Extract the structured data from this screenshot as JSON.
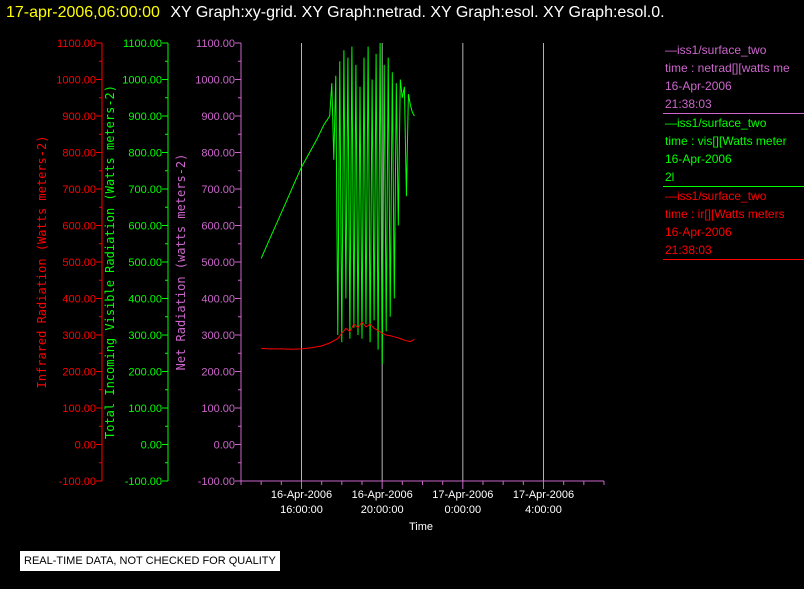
{
  "header": {
    "timestamp": "17-apr-2006,06:00:00",
    "graphs": "XY Graph:xy-grid.  XY Graph:netrad.  XY Graph:esol.  XY Graph:esol.0."
  },
  "legend": [
    {
      "lines": [
        "—iss1/surface_two",
        "time : netrad[][watts me",
        "16-Apr-2006",
        "21:38:03"
      ],
      "color": "#cc66cc"
    },
    {
      "lines": [
        "—iss1/surface_two",
        "time : vis[][Watts meter",
        "16-Apr-2006",
        "2l"
      ],
      "color": "#00ff00"
    },
    {
      "lines": [
        "—iss1/surface_two",
        "time : ir[][Watts meters",
        "16-Apr-2006",
        "21:38:03"
      ],
      "color": "#ff0000"
    }
  ],
  "footer": {
    "quality_note": "REAL-TIME DATA, NOT CHECKED FOR QUALITY"
  },
  "chart_data": {
    "type": "line",
    "xlabel": "Time",
    "x_ticks": [
      {
        "date": "16-Apr-2006",
        "time": "16:00:00",
        "hours": 16
      },
      {
        "date": "16-Apr-2006",
        "time": "20:00:00",
        "hours": 20
      },
      {
        "date": "17-Apr-2006",
        "time": "0:00:00",
        "hours": 24
      },
      {
        "date": "17-Apr-2006",
        "time": "4:00:00",
        "hours": 28
      }
    ],
    "xlim": [
      "16-Apr-2006 13:00",
      "17-Apr-2006 07:00"
    ],
    "xlim_hours": [
      13,
      31
    ],
    "grid": true,
    "axes": [
      {
        "id": "ir",
        "label": "Infrared Radiation (Watts meters-2)",
        "color": "#ff0000",
        "ylim": [
          -100,
          1100
        ],
        "ticks": [
          "-100.00",
          "0.00",
          "100.00",
          "200.00",
          "300.00",
          "400.00",
          "500.00",
          "600.00",
          "700.00",
          "800.00",
          "900.00",
          "1000.00",
          "1100.00"
        ]
      },
      {
        "id": "vis",
        "label": "Total Incoming Visible Radiation (Watts meters-2)",
        "color": "#00ff00",
        "ylim": [
          -100,
          1100
        ],
        "ticks": [
          "-100.00",
          "0.00",
          "100.00",
          "200.00",
          "300.00",
          "400.00",
          "500.00",
          "600.00",
          "700.00",
          "800.00",
          "900.00",
          "1000.00",
          "1100.00"
        ]
      },
      {
        "id": "net",
        "label": "Net Radiation (watts meters-2)",
        "color": "#cc66cc",
        "ylim": [
          -100,
          1100
        ],
        "ticks": [
          "-100.00",
          "0.00",
          "100.00",
          "200.00",
          "300.00",
          "400.00",
          "500.00",
          "600.00",
          "700.00",
          "800.00",
          "900.00",
          "1000.00",
          "1100.00"
        ]
      }
    ],
    "series": [
      {
        "name": "time : vis[][Watts meter",
        "axis": "vis",
        "color": "#00ff00",
        "x": [
          14.0,
          14.4,
          14.8,
          15.2,
          15.6,
          16.0,
          16.4,
          16.8,
          17.1,
          17.4,
          17.5,
          17.6,
          17.7,
          17.8,
          17.9,
          18.0,
          18.1,
          18.2,
          18.3,
          18.4,
          18.5,
          18.6,
          18.7,
          18.8,
          18.9,
          19.0,
          19.1,
          19.2,
          19.3,
          19.4,
          19.5,
          19.6,
          19.7,
          19.8,
          19.9,
          20.0,
          20.1,
          20.2,
          20.3,
          20.4,
          20.5,
          20.6,
          20.7,
          20.8,
          20.9,
          21.0,
          21.1,
          21.2,
          21.3,
          21.4,
          21.5,
          21.6
        ],
        "y": [
          510,
          560,
          610,
          660,
          710,
          760,
          800,
          840,
          875,
          900,
          990,
          780,
          1010,
          300,
          1050,
          280,
          1080,
          400,
          1060,
          290,
          1090,
          320,
          1040,
          300,
          980,
          290,
          1060,
          330,
          1090,
          280,
          1000,
          340,
          1070,
          260,
          1100,
          220,
          1040,
          310,
          1060,
          350,
          1020,
          400,
          990,
          600,
          1000,
          950,
          980,
          680,
          960,
          930,
          910,
          900
        ]
      },
      {
        "name": "time : ir[][Watts meters",
        "axis": "ir",
        "color": "#ff0000",
        "x": [
          14.0,
          14.5,
          15.0,
          15.5,
          16.0,
          16.5,
          17.0,
          17.4,
          17.8,
          18.0,
          18.2,
          18.4,
          18.6,
          18.8,
          19.0,
          19.2,
          19.4,
          19.6,
          19.8,
          20.0,
          20.2,
          20.4,
          20.6,
          20.8,
          21.0,
          21.2,
          21.4,
          21.6
        ],
        "y": [
          263,
          262,
          262,
          261,
          262,
          265,
          270,
          278,
          290,
          305,
          318,
          310,
          330,
          320,
          335,
          322,
          330,
          318,
          312,
          305,
          300,
          298,
          295,
          292,
          288,
          284,
          282,
          288
        ]
      }
    ]
  }
}
